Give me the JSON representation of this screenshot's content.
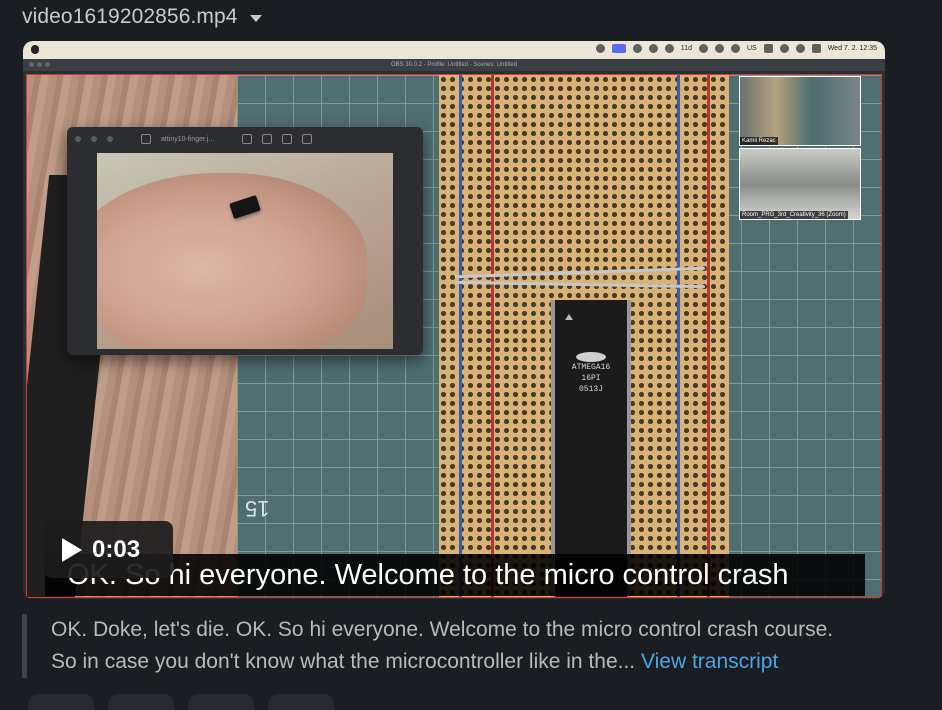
{
  "file": {
    "name": "video1619202856.mp4"
  },
  "macos_menubar": {
    "status_text": "Wed 7. 2.  12:35",
    "battery_label": "11d",
    "badge": "US"
  },
  "obs": {
    "title": "OBS 30.0.2 - Profile: Untitled - Scenes: Untitled"
  },
  "preview_window": {
    "title": "attiny10-finger.j..."
  },
  "chip": {
    "line1": "ATMEGA16",
    "line2": "16PI",
    "line3": "0513J"
  },
  "mat": {
    "number": "15"
  },
  "webcams": [
    {
      "label": "Kamil Rezac"
    },
    {
      "label": "Room_PRG_3rd_Creativity_36 (Zoom)"
    }
  ],
  "player": {
    "time": "0:03",
    "caption": "OK. So hi everyone. Welcome to the micro control crash"
  },
  "transcript": {
    "line1": "OK. Doke, let's die. OK. So hi everyone. Welcome to the micro control crash course.",
    "line2": "So in case you don't know what the microcontroller like in the...",
    "link": "View transcript"
  }
}
